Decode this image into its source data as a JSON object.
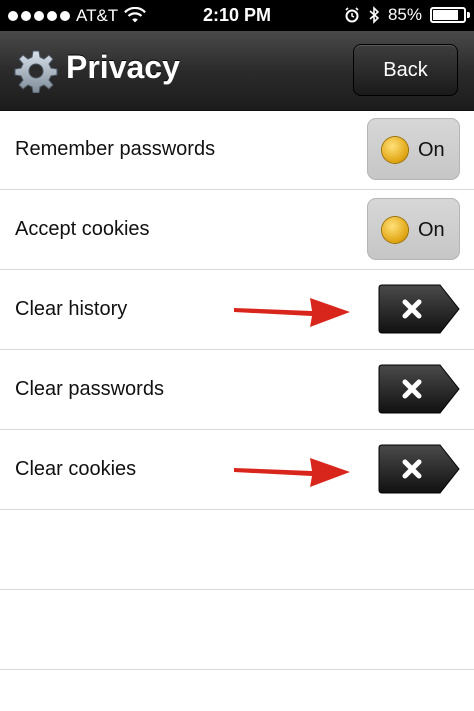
{
  "status": {
    "carrier": "AT&T",
    "time": "2:10 PM",
    "battery_percent_text": "85%",
    "battery_level": 0.85
  },
  "nav": {
    "title": "Privacy",
    "back_label": "Back",
    "icon": "gear-icon"
  },
  "rows": [
    {
      "label": "Remember passwords",
      "control": "toggle",
      "state": "On"
    },
    {
      "label": "Accept cookies",
      "control": "toggle",
      "state": "On"
    },
    {
      "label": "Clear history",
      "control": "clear-button",
      "icon": "close-icon",
      "annotated": true
    },
    {
      "label": "Clear passwords",
      "control": "clear-button",
      "icon": "close-icon",
      "annotated": false
    },
    {
      "label": "Clear cookies",
      "control": "clear-button",
      "icon": "close-icon",
      "annotated": true
    }
  ],
  "colors": {
    "accent_arrow": "#d9261c",
    "toggle_on_dot": "#e0a410",
    "navbar": "#2b2b2b"
  }
}
